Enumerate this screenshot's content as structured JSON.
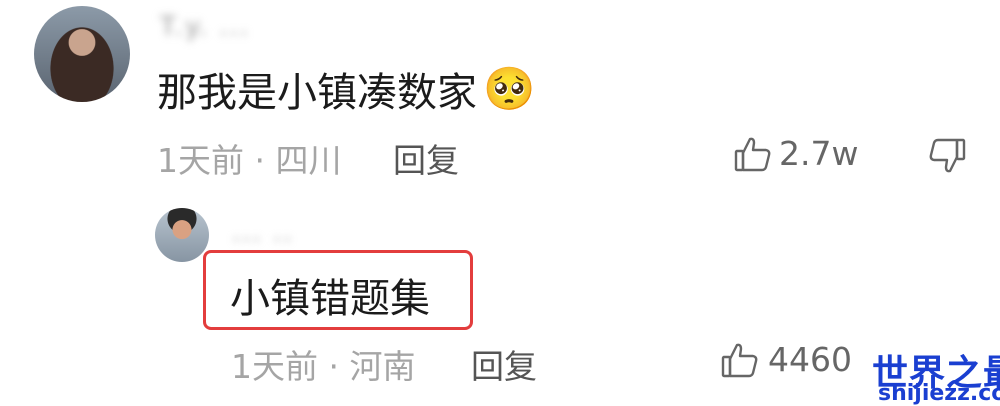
{
  "comment": {
    "username": "T.y. ...",
    "text": "那我是小镇凑数家",
    "emoji": "🥺",
    "time_location": "1天前 · 四川",
    "reply_label": "回复",
    "like_count": "2.7w"
  },
  "reply": {
    "username": "... ..",
    "text": "小镇错题集",
    "time_location": "1天前 · 河南",
    "reply_label": "回复",
    "like_count": "4460"
  },
  "watermark": {
    "name": "世界之最",
    "url": "shijiezz.com"
  },
  "colors": {
    "highlight": "#e33d3d",
    "watermark": "#1a3fd1"
  }
}
